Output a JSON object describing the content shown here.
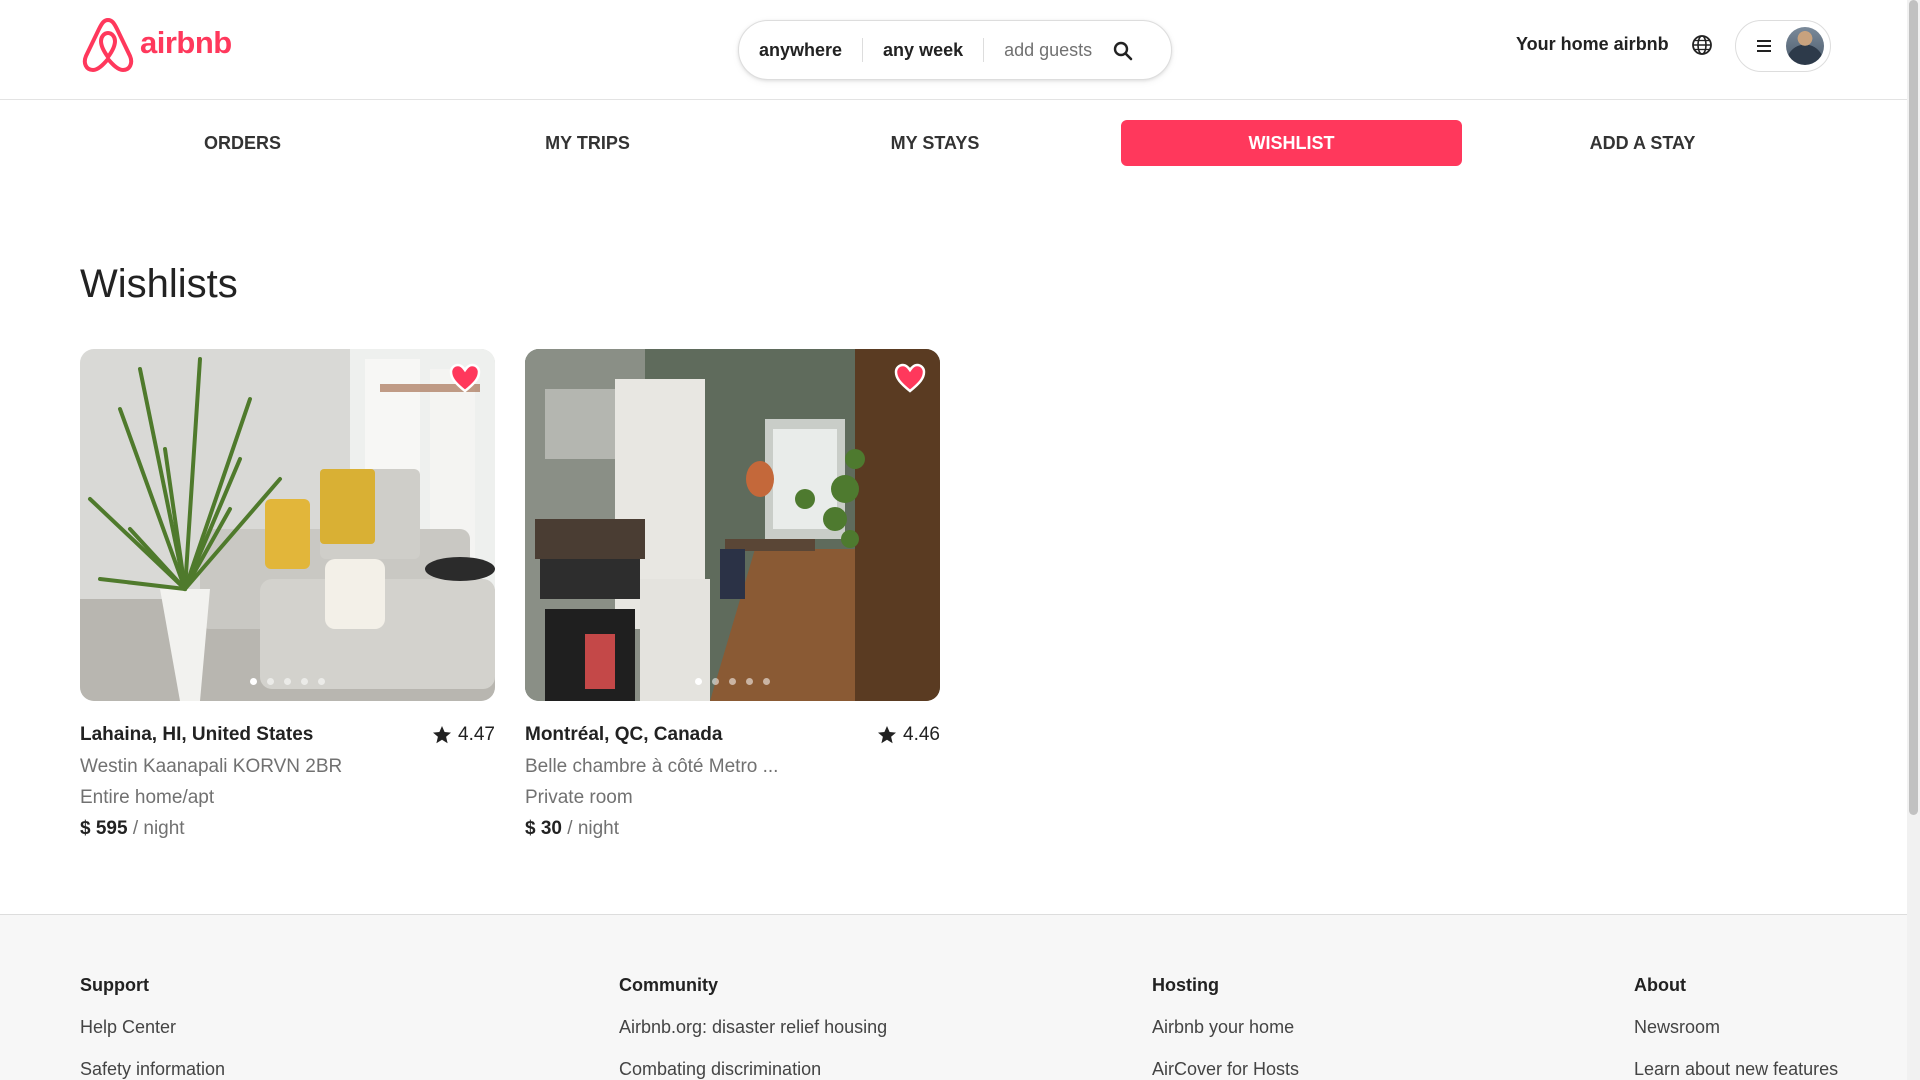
{
  "brand": {
    "name": "airbnb",
    "color": "#ff385c",
    "icon": "airbnb-logo-icon"
  },
  "search": {
    "where": "anywhere",
    "when": "any week",
    "guests_placeholder": "add guests",
    "icon": "search-icon"
  },
  "header": {
    "host_link": "Your home airbnb",
    "globe_icon": "globe-icon",
    "menu_icon": "menu-icon"
  },
  "tabs": [
    {
      "label": "ORDERS",
      "active": false
    },
    {
      "label": "MY TRIPS",
      "active": false
    },
    {
      "label": "MY STAYS",
      "active": false
    },
    {
      "label": "WISHLIST",
      "active": true
    },
    {
      "label": "ADD A STAY",
      "active": false
    }
  ],
  "main": {
    "title": "Wishlists",
    "listings": [
      {
        "location": "Lahaina, HI, United States",
        "rating": "4.47",
        "name": "Westin Kaanapali KORVN 2BR",
        "type": "Entire home/apt",
        "price": "$ 595",
        "unit": "/ night",
        "favorited": true,
        "photo_count": 5,
        "current_photo": 1
      },
      {
        "location": "Montréal, QC, Canada",
        "rating": "4.46",
        "name": "Belle chambre à côté Metro ...",
        "type": "Private room",
        "price": "$ 30",
        "unit": "/ night",
        "favorited": true,
        "photo_count": 5,
        "current_photo": 1
      }
    ]
  },
  "footer": {
    "columns": [
      {
        "heading": "Support",
        "links": [
          "Help Center",
          "Safety information"
        ]
      },
      {
        "heading": "Community",
        "links": [
          "Airbnb.org: disaster relief housing",
          "Combating discrimination"
        ]
      },
      {
        "heading": "Hosting",
        "links": [
          "Airbnb your home",
          "AirCover for Hosts"
        ]
      },
      {
        "heading": "About",
        "links": [
          "Newsroom",
          "Learn about new features"
        ]
      }
    ]
  }
}
